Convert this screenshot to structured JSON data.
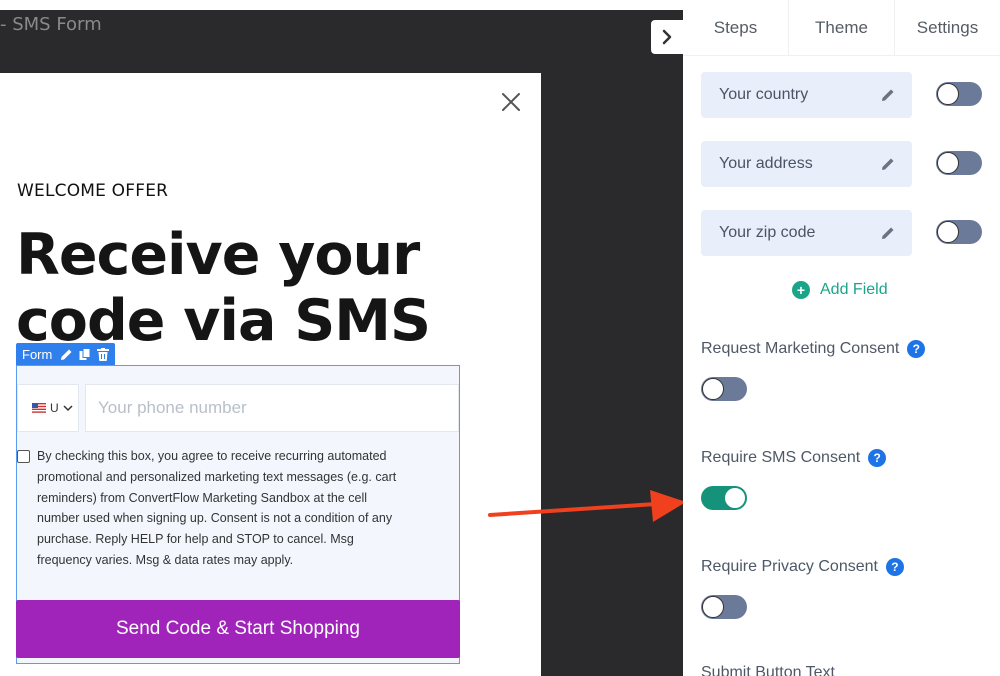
{
  "editor": {
    "title": "- SMS Form"
  },
  "popup": {
    "eyebrow": "WELCOME OFFER",
    "headline": "Receive your code via SMS",
    "form_tag_label": "Form",
    "country_code": "U",
    "phone_placeholder": "Your phone number",
    "consent_text": "By checking this box, you agree to receive recurring automated promotional and personalized marketing text messages (e.g. cart reminders) from ConvertFlow Marketing Sandbox at the cell number used when signing up. Consent is not a condition of any purchase. Reply HELP for help and STOP to cancel. Msg frequency varies. Msg & data rates may apply.",
    "cta_label": "Send Code & Start Shopping",
    "cta_color": "#a024ba"
  },
  "panel": {
    "tabs": [
      {
        "label": "Steps"
      },
      {
        "label": "Theme"
      },
      {
        "label": "Settings"
      }
    ],
    "fields": [
      {
        "label": "Your country",
        "enabled": false
      },
      {
        "label": "Your address",
        "enabled": false
      },
      {
        "label": "Your zip code",
        "enabled": false
      }
    ],
    "add_field_label": "Add Field",
    "settings": [
      {
        "label": "Request Marketing Consent",
        "enabled": false
      },
      {
        "label": "Require SMS Consent",
        "enabled": true
      },
      {
        "label": "Require Privacy Consent",
        "enabled": false
      }
    ],
    "submit_label": "Submit Button Text",
    "accent_color": "#15927a"
  }
}
